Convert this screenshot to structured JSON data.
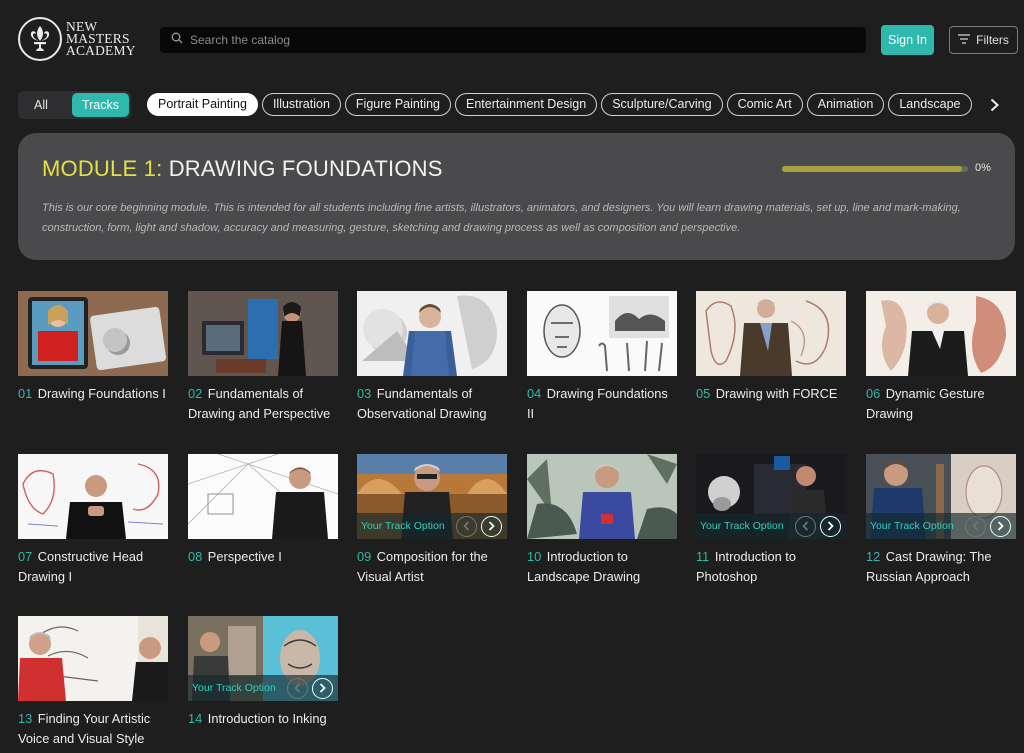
{
  "brand": {
    "line1": "NEW",
    "line2": "MASTERS",
    "line3": "ACADEMY"
  },
  "search": {
    "placeholder": "Search the catalog"
  },
  "header": {
    "signin_label": "Sign In",
    "filters_label": "Filters"
  },
  "view_toggle": {
    "all_label": "All",
    "tracks_label": "Tracks",
    "selected": "Tracks"
  },
  "categories": [
    "Portrait Painting",
    "Illustration",
    "Figure Painting",
    "Entertainment Design",
    "Sculpture/Carving",
    "Comic Art",
    "Animation",
    "Landscape"
  ],
  "active_category": "Portrait Painting",
  "module": {
    "prefix": "MODULE 1:",
    "name": "DRAWING FOUNDATIONS",
    "progress_text": "0%",
    "progress_fraction": 0.97,
    "description": "This is our core beginning module. This is intended for all students including fine artists, illustrators, animators, and designers. You will learn drawing materials, set up, line and mark-making, construction, form, light and shadow, accuracy and measuring, gesture, sketching and drawing process as well as composition and perspective."
  },
  "track_option_label": "Your Track Option",
  "courses": [
    {
      "num": "01",
      "title": "Drawing Foundations I",
      "track_option": false
    },
    {
      "num": "02",
      "title": "Fundamentals of Drawing and Perspective",
      "track_option": false
    },
    {
      "num": "03",
      "title": "Fundamentals of Observational Drawing",
      "track_option": false
    },
    {
      "num": "04",
      "title": "Drawing Foundations II",
      "track_option": false
    },
    {
      "num": "05",
      "title": "Drawing with FORCE",
      "track_option": false
    },
    {
      "num": "06",
      "title": "Dynamic Gesture Drawing",
      "track_option": false
    },
    {
      "num": "07",
      "title": "Constructive Head Drawing I",
      "track_option": false
    },
    {
      "num": "08",
      "title": "Perspective I",
      "track_option": false
    },
    {
      "num": "09",
      "title": "Composition for the Visual Artist",
      "track_option": true
    },
    {
      "num": "10",
      "title": "Introduction to Landscape Drawing",
      "track_option": false
    },
    {
      "num": "11",
      "title": "Introduction to Photoshop",
      "track_option": true
    },
    {
      "num": "12",
      "title": "Cast Drawing: The Russian Approach",
      "track_option": true
    },
    {
      "num": "13",
      "title": "Finding Your Artistic Voice and Visual Style",
      "track_option": false
    },
    {
      "num": "14",
      "title": "Introduction to Inking",
      "track_option": true
    }
  ],
  "colors": {
    "accent": "#2fb8ac",
    "module_prefix": "#e3e140",
    "background": "#1e1e1f",
    "panel": "#4a4a4c"
  },
  "icons": {
    "logo": "fleur-de-lis-icon",
    "search": "search-icon",
    "filters": "filter-lines-icon",
    "categories_next": "chevron-right-icon"
  }
}
